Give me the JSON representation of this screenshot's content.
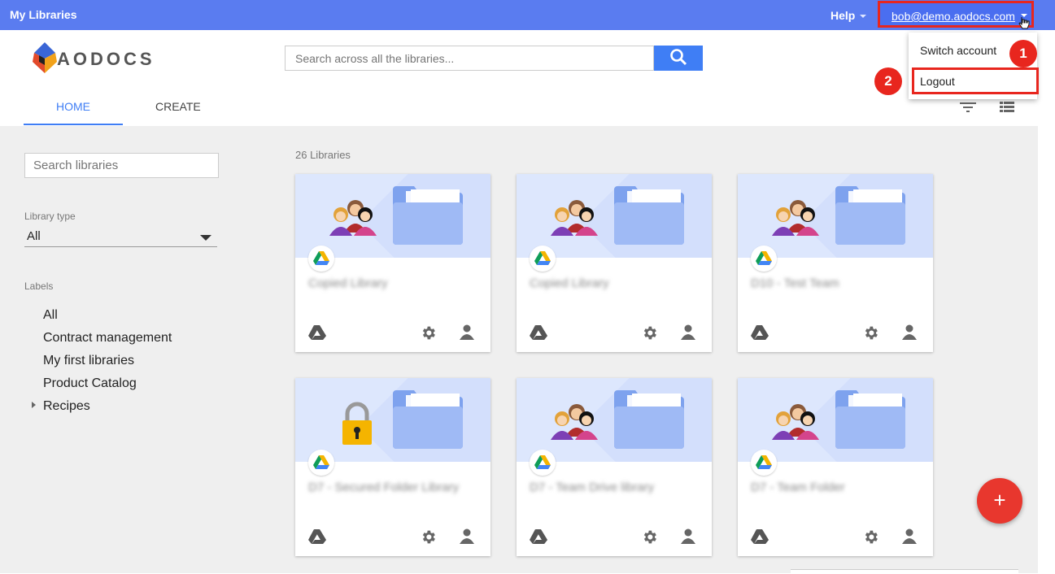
{
  "topbar": {
    "app_title": "My Libraries",
    "help_label": "Help",
    "user_email": "bob@demo.aodocs.com",
    "bg_color": "#5a7cf0"
  },
  "header": {
    "logo_text": "AODOCS",
    "search_placeholder": "Search across all the libraries...",
    "tabs": [
      {
        "label": "HOME",
        "active": true
      },
      {
        "label": "CREATE",
        "active": false
      }
    ]
  },
  "user_menu": {
    "items": [
      {
        "label": "Switch account"
      },
      {
        "label": "Logout"
      }
    ],
    "steps": [
      "1",
      "2"
    ]
  },
  "sidebar": {
    "search_placeholder": "Search libraries",
    "library_type_label": "Library type",
    "library_type_value": "All",
    "labels_title": "Labels",
    "labels": [
      "All",
      "Contract management",
      "My first libraries",
      "Product Catalog",
      "Recipes"
    ]
  },
  "main": {
    "library_count": "26 Libraries",
    "cards": [
      {
        "title": "Copied Library",
        "art": "people-icon"
      },
      {
        "title": "Copied Library",
        "art": "people-icon"
      },
      {
        "title": "D10 - Test Team",
        "art": "people-icon"
      },
      {
        "title": "D7 - Secured Folder Library",
        "art": "lock-icon"
      },
      {
        "title": "D7 - Team Drive library",
        "art": "people-icon"
      },
      {
        "title": "D7 - Team Folder",
        "art": "people-icon"
      }
    ]
  },
  "fab": {
    "label": "+"
  },
  "colors": {
    "accent": "#3f7ef5",
    "danger": "#e8261e",
    "fab": "#e8372e"
  }
}
